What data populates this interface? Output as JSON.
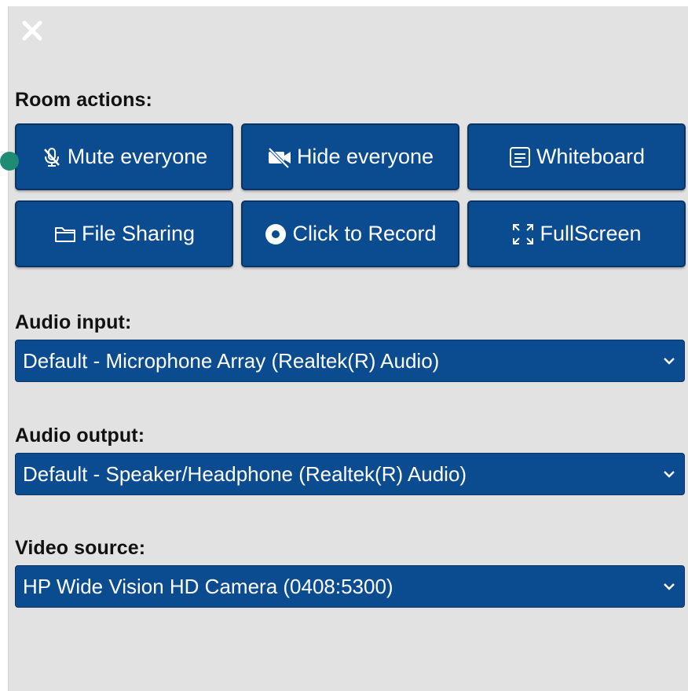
{
  "room_actions": {
    "label": "Room actions:",
    "buttons": [
      {
        "label": "Mute everyone",
        "icon": "mic-off-icon"
      },
      {
        "label": "Hide everyone",
        "icon": "video-off-icon"
      },
      {
        "label": "Whiteboard",
        "icon": "whiteboard-icon"
      },
      {
        "label": "File Sharing",
        "icon": "folder-icon"
      },
      {
        "label": "Click to Record",
        "icon": "record-icon"
      },
      {
        "label": "FullScreen",
        "icon": "fullscreen-icon"
      }
    ]
  },
  "audio_input": {
    "label": "Audio input:",
    "selected": "Default - Microphone Array (Realtek(R) Audio)"
  },
  "audio_output": {
    "label": "Audio output:",
    "selected": "Default - Speaker/Headphone (Realtek(R) Audio)"
  },
  "video_source": {
    "label": "Video source:",
    "selected": "HP Wide Vision HD Camera (0408:5300)"
  },
  "colors": {
    "panel_bg": "#e2e2e2",
    "button_bg": "#0b4c91",
    "button_border": "#0a3462",
    "cursor_marker": "#1e8c74"
  }
}
